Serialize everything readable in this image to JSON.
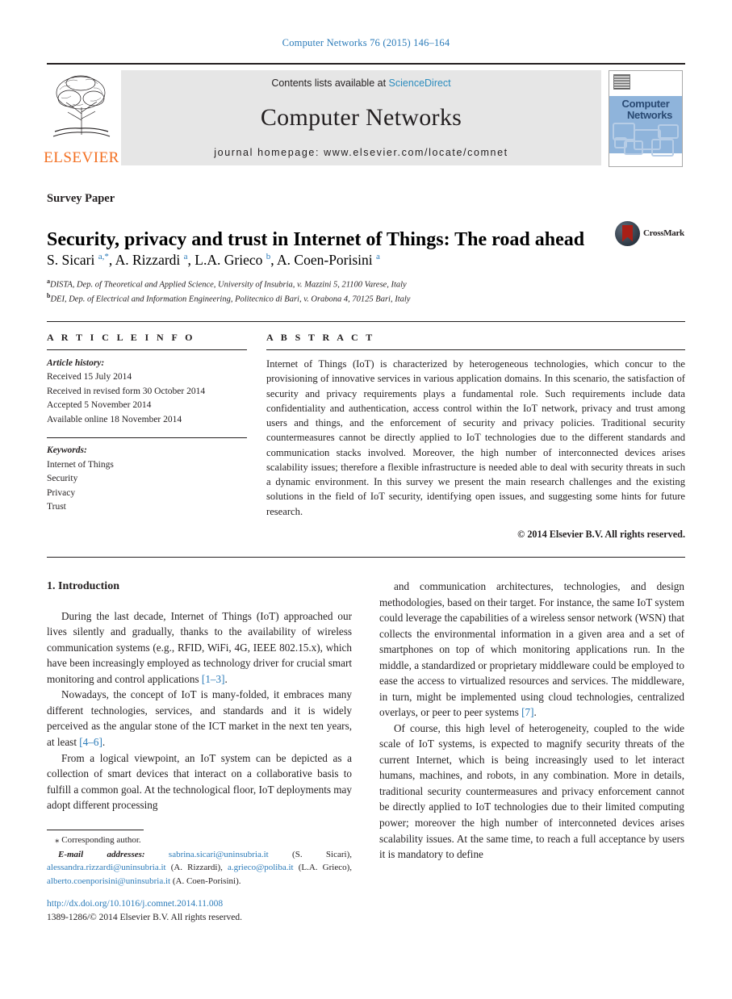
{
  "running_head": "Computer Networks 76 (2015) 146–164",
  "masthead": {
    "contents_prefix": "Contents lists available at",
    "sciencedirect": "ScienceDirect",
    "journal_name": "Computer Networks",
    "homepage": "journal homepage: www.elsevier.com/locate/comnet",
    "publisher": "ELSEVIER",
    "cover_title_line1": "Computer",
    "cover_title_line2": "Networks"
  },
  "article": {
    "type_label": "Survey Paper",
    "title": "Security, privacy and trust in Internet of Things: The road ahead",
    "crossmark_label": "CrossMark",
    "authors_html": "S. Sicari <sup>a,*</sup>, A. Rizzardi <sup>a</sup>, L.A. Grieco <sup>b</sup>, A. Coen-Porisini <sup>a</sup>",
    "affiliation_a": "DISTA, Dep. of Theoretical and Applied Science, University of Insubria, v. Mazzini 5, 21100 Varese, Italy",
    "affiliation_b": "DEI, Dep. of Electrical and Information Engineering, Politecnico di Bari, v. Orabona 4, 70125 Bari, Italy"
  },
  "article_info": {
    "heading": "A R T I C L E   I N F O",
    "history_label": "Article history:",
    "history": [
      "Received 15 July 2014",
      "Received in revised form 30 October 2014",
      "Accepted 5 November 2014",
      "Available online 18 November 2014"
    ],
    "keywords_label": "Keywords:",
    "keywords": [
      "Internet of Things",
      "Security",
      "Privacy",
      "Trust"
    ]
  },
  "abstract": {
    "heading": "A B S T R A C T",
    "text": "Internet of Things (IoT) is characterized by heterogeneous technologies, which concur to the provisioning of innovative services in various application domains. In this scenario, the satisfaction of security and privacy requirements plays a fundamental role. Such requirements include data confidentiality and authentication, access control within the IoT network, privacy and trust among users and things, and the enforcement of security and privacy policies. Traditional security countermeasures cannot be directly applied to IoT technologies due to the different standards and communication stacks involved. Moreover, the high number of interconnected devices arises scalability issues; therefore a flexible infrastructure is needed able to deal with security threats in such a dynamic environment. In this survey we present the main research challenges and the existing solutions in the field of IoT security, identifying open issues, and suggesting some hints for future research.",
    "copyright": "© 2014 Elsevier B.V. All rights reserved."
  },
  "body": {
    "section_number_title": "1. Introduction",
    "left_paragraphs": [
      "During the last decade, Internet of Things (IoT) approached our lives silently and gradually, thanks to the availability of wireless communication systems (e.g., RFID, WiFi, 4G, IEEE 802.15.x), which have been increasingly employed as technology driver for crucial smart monitoring and control applications [1–3].",
      "Nowadays, the concept of IoT is many-folded, it embraces many different technologies, services, and standards and it is widely perceived as the angular stone of the ICT market in the next ten years, at least [4–6].",
      "From a logical viewpoint, an IoT system can be depicted as a collection of smart devices that interact on a collaborative basis to fulfill a common goal. At the technological floor, IoT deployments may adopt different processing"
    ],
    "right_paragraphs": [
      "and communication architectures, technologies, and design methodologies, based on their target. For instance, the same IoT system could leverage the capabilities of a wireless sensor network (WSN) that collects the environmental information in a given area and a set of smartphones on top of which monitoring applications run. In the middle, a standardized or proprietary middleware could be employed to ease the access to virtualized resources and services. The middleware, in turn, might be implemented using cloud technologies, centralized overlays, or peer to peer systems [7].",
      "Of course, this high level of heterogeneity, coupled to the wide scale of IoT systems, is expected to magnify security threats of the current Internet, which is being increasingly used to let interact humans, machines, and robots, in any combination. More in details, traditional security countermeasures and privacy enforcement cannot be directly applied to IoT technologies due to their limited computing power; moreover the high number of interconneted devices arises scalability issues. At the same time, to reach a full acceptance by users it is mandatory to define"
    ]
  },
  "footnotes": {
    "corresponding": "⁎ Corresponding author.",
    "email_label": "E-mail addresses:",
    "emails": [
      {
        "address": "sabrina.sicari@uninsubria.it",
        "name": "(S. Sicari)"
      },
      {
        "address": "alessandra.rizzardi@uninsubria.it",
        "name": "(A. Rizzardi)"
      },
      {
        "address": "a.grieco@poliba.it",
        "name": "(L.A. Grieco)"
      },
      {
        "address": "alberto.coenporisini@uninsubria.it",
        "name": "(A. Coen-Porisini)"
      }
    ]
  },
  "footer": {
    "doi": "http://dx.doi.org/10.1016/j.comnet.2014.11.008",
    "issn_line": "1389-1286/© 2014 Elsevier B.V. All rights reserved."
  },
  "colors": {
    "link": "#2b7bb9",
    "sciencedirect": "#2b8cbe",
    "elsevier_orange": "#f36f21",
    "cover_blue": "#8fb4db",
    "band_gray": "#e6e6e6"
  }
}
